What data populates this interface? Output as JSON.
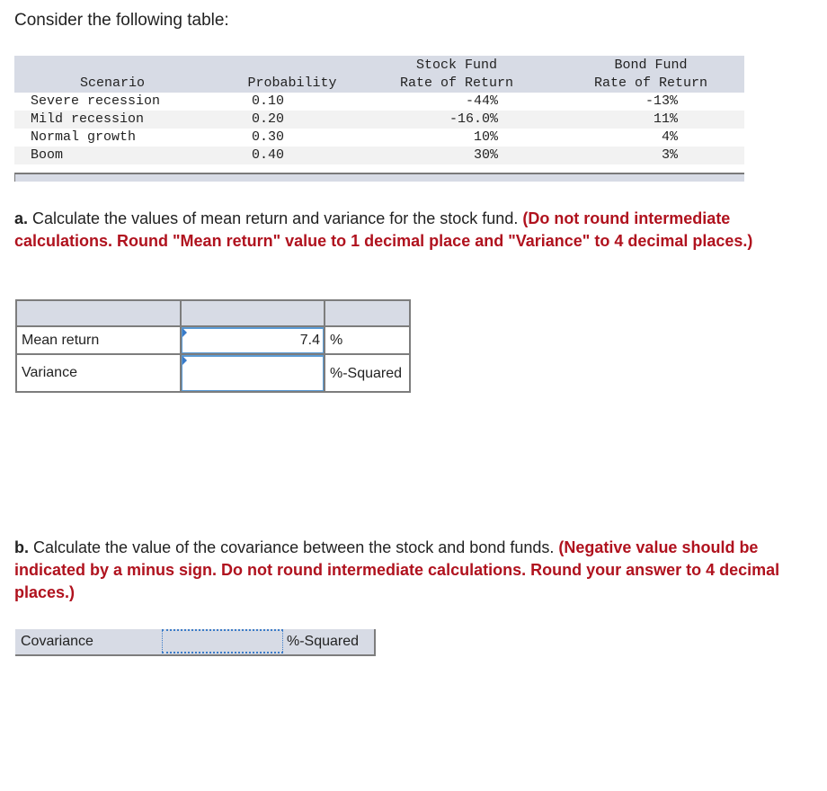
{
  "intro": "Consider the following table:",
  "data_table": {
    "headers": {
      "scenario": "Scenario",
      "probability": "Probability",
      "stock_line1": "Stock Fund",
      "stock_line2": "Rate of Return",
      "bond_line1": "Bond Fund",
      "bond_line2": "Rate of Return"
    },
    "rows": [
      {
        "scenario": "Severe recession",
        "probability": "0.10",
        "stock": "-44%",
        "bond": "-13%"
      },
      {
        "scenario": "Mild recession",
        "probability": "0.20",
        "stock": "-16.0%",
        "bond": "11%"
      },
      {
        "scenario": "Normal growth",
        "probability": "0.30",
        "stock": "10%",
        "bond": "4%"
      },
      {
        "scenario": "Boom",
        "probability": "0.40",
        "stock": "30%",
        "bond": "3%"
      }
    ]
  },
  "part_a": {
    "label": "a.",
    "text": " Calculate the values of mean return and variance for the stock fund. ",
    "instruction": "(Do not round intermediate calculations. Round \"Mean return\" value to 1 decimal place and \"Variance\" to 4 decimal places.)",
    "rows": [
      {
        "label": "Mean return",
        "value": "7.4",
        "placeholder": "",
        "unit": "%"
      },
      {
        "label": "Variance",
        "value": "",
        "placeholder": "",
        "unit": "%-Squared"
      }
    ]
  },
  "part_b": {
    "label": "b.",
    "text": " Calculate the value of the covariance between the stock and bond funds. ",
    "instruction": "(Negative value should be indicated by a minus sign. Do not round intermediate calculations. Round your answer to 4 decimal places.)",
    "row": {
      "label": "Covariance",
      "value": "",
      "unit": "%-Squared"
    }
  },
  "colors": {
    "header_bg": "#d7dbe5",
    "instruction_red": "#b0121e",
    "input_border": "#5b9bd5"
  }
}
